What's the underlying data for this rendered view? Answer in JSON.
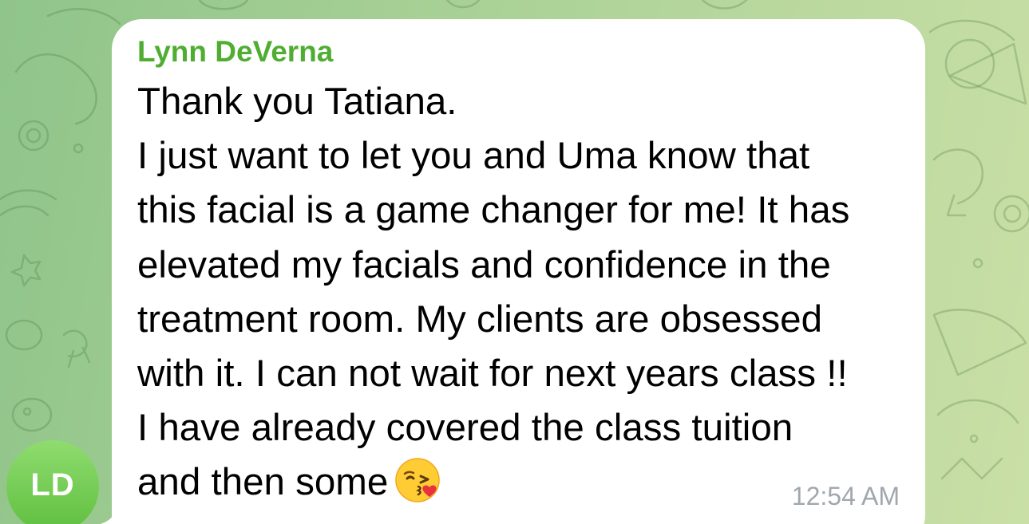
{
  "chat": {
    "avatar_initials": "LD",
    "avatar_color": "#6cc94c",
    "accent_color": "#4fae32",
    "message": {
      "sender": "Lynn DeVerna",
      "lines": [
        "Thank you Tatiana.",
        "I just want to let you and Uma know that",
        "this facial is a game changer for me! It has",
        "elevated my facials and confidence in the",
        "treatment room. My clients are obsessed",
        "with it. I can not wait for next years class !!",
        "I have already covered the class tuition",
        "and then some"
      ],
      "emoji": "kissing-face-with-heart-emoji",
      "time": "12:54 AM"
    }
  }
}
